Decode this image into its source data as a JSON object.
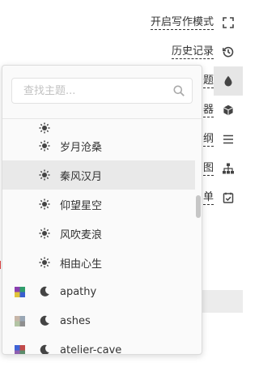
{
  "toolbar": {
    "items": [
      {
        "label": "开启写作模式",
        "icon": "fullscreen-icon"
      },
      {
        "label": "历史记录",
        "icon": "history-icon"
      },
      {
        "label": "题",
        "icon": "theme-drop-icon",
        "active": true
      },
      {
        "label": "器",
        "icon": "cube-icon"
      },
      {
        "label": "纲",
        "icon": "list-icon"
      },
      {
        "label": "图",
        "icon": "sitemap-icon"
      },
      {
        "label": "单",
        "icon": "checklist-icon"
      }
    ]
  },
  "theme_panel": {
    "search_placeholder": "查找主题...",
    "items": [
      {
        "label": "岁月沧桑",
        "mode": "light",
        "selected": false
      },
      {
        "label": "秦风汉月",
        "mode": "light",
        "selected": true
      },
      {
        "label": "仰望星空",
        "mode": "light",
        "selected": false
      },
      {
        "label": "风吹麦浪",
        "mode": "light",
        "selected": false
      },
      {
        "label": "相由心生",
        "mode": "light",
        "selected": false
      },
      {
        "label": "apathy",
        "mode": "dark",
        "selected": false,
        "swatch": [
          "#8a3fb0",
          "#2f9e6b",
          "#e0c33a",
          "#3a5fcf"
        ]
      },
      {
        "label": "ashes",
        "mode": "dark",
        "selected": false,
        "swatch": [
          "#c7b6a8",
          "#9aa7b5",
          "#b3c4a4",
          "#8f8f8f"
        ]
      },
      {
        "label": "atelier-cave",
        "mode": "dark",
        "selected": false,
        "swatch": [
          "#3f63d6",
          "#c24a4a",
          "#8e5fb0",
          "#5b8c6a"
        ]
      }
    ]
  },
  "colors": {
    "accent_border": "#333333",
    "selected_bg": "#e9e9e9",
    "icon": "#444444"
  }
}
